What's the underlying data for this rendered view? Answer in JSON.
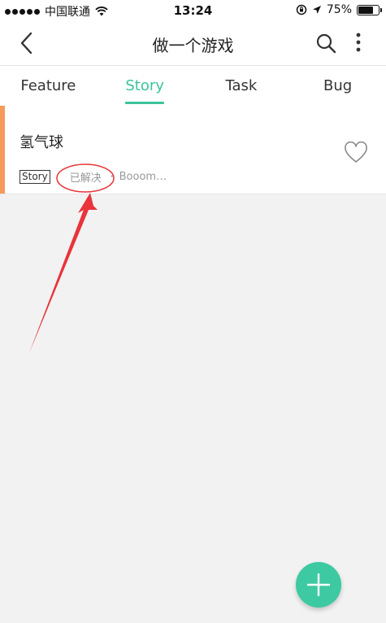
{
  "status_bar": {
    "carrier": "中国联通",
    "time": "13:24",
    "battery_percent": "75%",
    "battery_level": 0.75
  },
  "nav": {
    "title": "做一个游戏"
  },
  "tabs": [
    {
      "label": "Feature",
      "active": false
    },
    {
      "label": "Story",
      "active": true
    },
    {
      "label": "Task",
      "active": false
    },
    {
      "label": "Bug",
      "active": false
    }
  ],
  "items": [
    {
      "title": "氢气球",
      "tag": "Story",
      "status": "已解决",
      "author": "Booom…",
      "accent_color": "#f59a5b"
    }
  ],
  "colors": {
    "accent": "#3cc49a",
    "annotation": "#e8343a"
  }
}
